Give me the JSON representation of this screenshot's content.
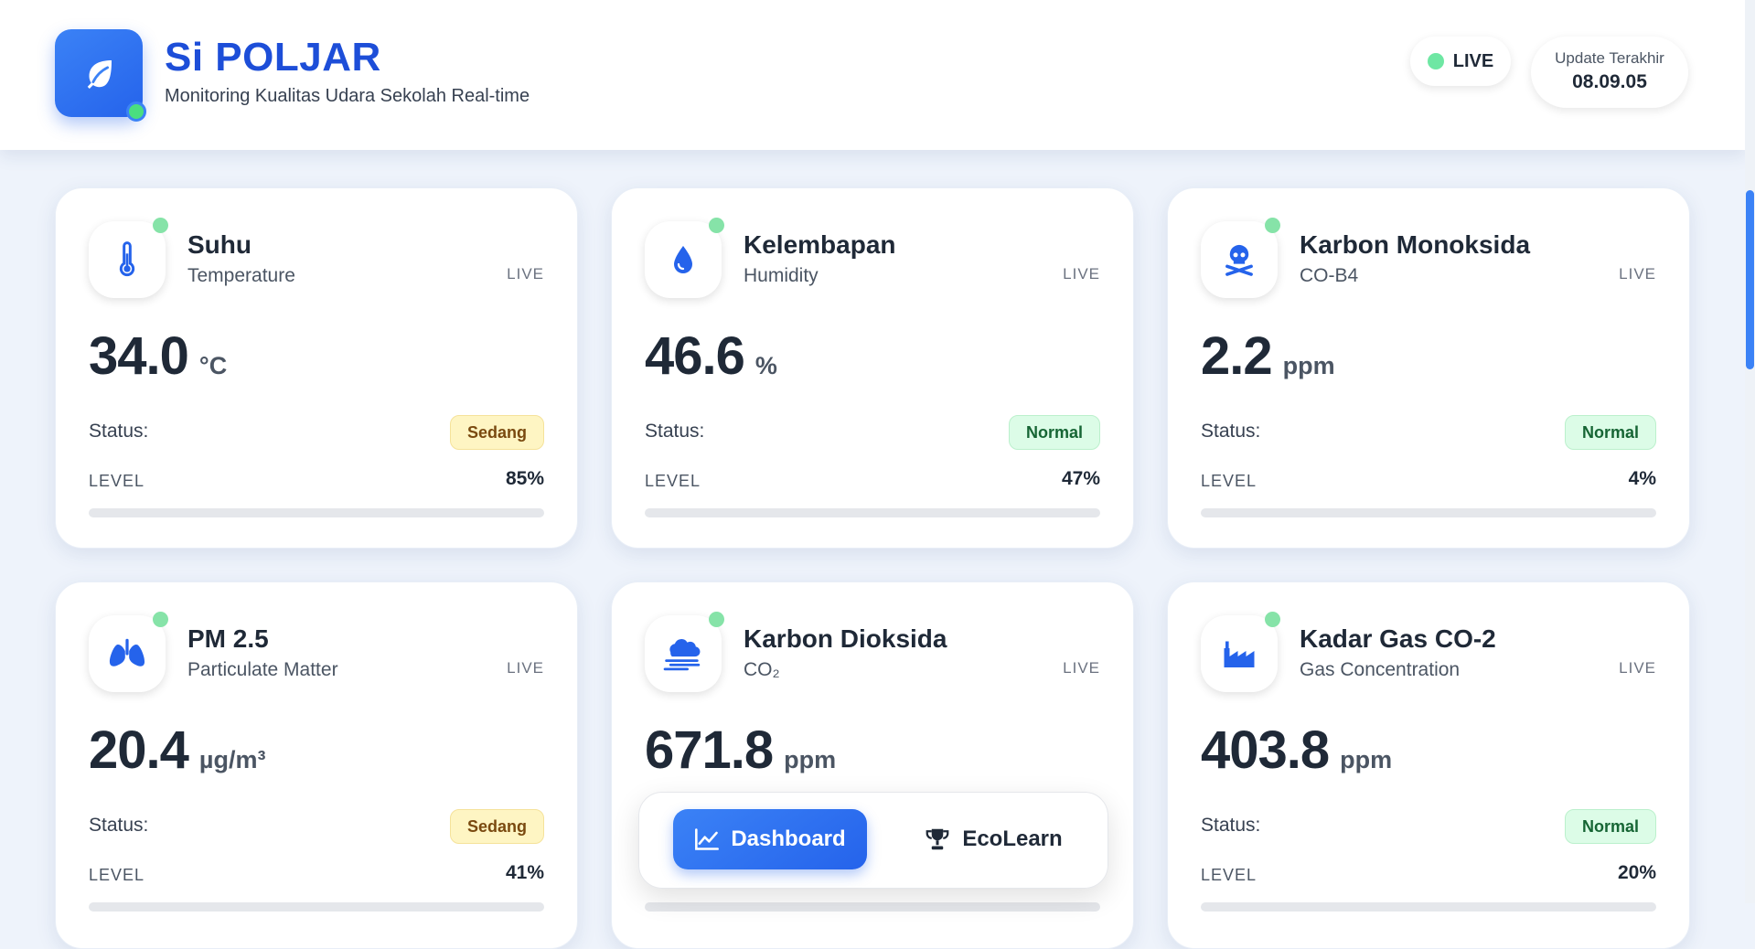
{
  "header": {
    "brand_title": "Si POLJAR",
    "brand_subtitle": "Monitoring Kualitas Udara Sekolah Real-time",
    "live_label": "LIVE",
    "update_label": "Update Terakhir",
    "update_time": "08.09.05"
  },
  "colors": {
    "primary": "#2563eb",
    "live_green": "#6ee7a3",
    "sedang_bg": "#fef5c3",
    "normal_bg": "#dcfce7"
  },
  "sensors": [
    {
      "title": "Suhu",
      "subtitle": "Temperature",
      "live": "LIVE",
      "value": "34.0",
      "unit": "°C",
      "status_label": "Status:",
      "status": "Sedang",
      "level_label": "LEVEL",
      "level": "85%",
      "level_fraction": 0.85,
      "icon": "thermometer-icon"
    },
    {
      "title": "Kelembapan",
      "subtitle": "Humidity",
      "live": "LIVE",
      "value": "46.6",
      "unit": "%",
      "status_label": "Status:",
      "status": "Normal",
      "level_label": "LEVEL",
      "level": "47%",
      "level_fraction": 0.47,
      "icon": "water-drop-icon"
    },
    {
      "title": "Karbon Monoksida",
      "subtitle": "CO-B4",
      "live": "LIVE",
      "value": "2.2",
      "unit": "ppm",
      "status_label": "Status:",
      "status": "Normal",
      "level_label": "LEVEL",
      "level": "4%",
      "level_fraction": 0.04,
      "icon": "skull-crossbones-icon"
    },
    {
      "title": "PM 2.5",
      "subtitle": "Particulate Matter",
      "live": "LIVE",
      "value": "20.4",
      "unit": "µg/m³",
      "status_label": "Status:",
      "status": "Sedang",
      "level_label": "LEVEL",
      "level": "41%",
      "level_fraction": 0.41,
      "icon": "lungs-icon"
    },
    {
      "title": "Karbon Dioksida",
      "subtitle": "CO₂",
      "live": "LIVE",
      "value": "671.8",
      "unit": "ppm",
      "status_label": "",
      "status": "",
      "level_label": "",
      "level": "",
      "icon": "smog-icon"
    },
    {
      "title": "Kadar Gas CO-2",
      "subtitle": "Gas Concentration",
      "live": "LIVE",
      "value": "403.8",
      "unit": "ppm",
      "status_label": "Status:",
      "status": "Normal",
      "level_label": "LEVEL",
      "level": "20%",
      "level_fraction": 0.2,
      "icon": "factory-icon"
    }
  ],
  "nav": {
    "dashboard_label": "Dashboard",
    "ecolearn_label": "EcoLearn"
  }
}
